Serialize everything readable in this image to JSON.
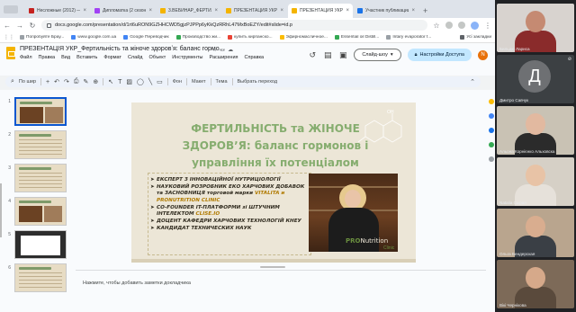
{
  "browser": {
    "tabs": [
      {
        "label": "Несложные (2012) — ...",
        "fav_color": "#c5221f",
        "active": false
      },
      {
        "label": "Дипломатка (2 сезон) ...",
        "fav_color": "#a142f4",
        "active": false
      },
      {
        "label": "3.ВЕБИНАР_ФЕРТИЛЬ...",
        "fav_color": "#f4b400",
        "active": false
      },
      {
        "label": "ПРЕЗЕНТАЦИЯ УКР_Фе...",
        "fav_color": "#f4b400",
        "active": false
      },
      {
        "label": "ПРЕЗЕНТАЦИЯ УКР_Фе...",
        "fav_color": "#f4b400",
        "active": true
      },
      {
        "label": "Участник публикации",
        "fav_color": "#1a73e8",
        "active": false
      }
    ],
    "new_tab": "+",
    "url": "docs.google.com/presentation/d/1rt6uRON9GZHHCWD5gjzPJPPp6yKkQzRRhL47MxBoEZY/edit#slide=id.p",
    "bookmarks": [
      {
        "label": "Попробуйте Брау...",
        "color": "#9aa0a6"
      },
      {
        "label": "www.google.com.ua",
        "color": "#4285f4"
      },
      {
        "label": "Google Переводчик",
        "color": "#4285f4"
      },
      {
        "label": "Производство жи...",
        "color": "#34a853"
      },
      {
        "label": "купить кирпанско...",
        "color": "#ea4335"
      },
      {
        "label": "Эфирномасличное...",
        "color": "#fbbc04"
      },
      {
        "label": "Essential oil Distill...",
        "color": "#34a853"
      },
      {
        "label": "Intary evaporator f...",
        "color": "#9aa0a6"
      }
    ],
    "all_bookmarks": "Усі закладки"
  },
  "docs": {
    "title": "ПРЕЗЕНТАЦІЯ УКР_Фертильність та жіноче здоровʼя: баланс гормо...",
    "menu": [
      "Файл",
      "Правка",
      "Вид",
      "Вставить",
      "Формат",
      "Слайд",
      "Объект",
      "Инструменты",
      "Расширения",
      "Справка"
    ],
    "slideshow_label": "Слайд-шоу",
    "access_label": "Настройки Доступа",
    "avatar_letter": "N",
    "toolbar": {
      "search_label": "По шир",
      "background_label": "Фон",
      "layout_label": "Макет",
      "theme_label": "Тема",
      "transition_label": "Выбрать переход"
    },
    "notes_placeholder": "Нажмите, чтобы добавить заметки докладчика"
  },
  "thumbnails": [
    {
      "num": "1",
      "style": "title",
      "selected": true
    },
    {
      "num": "2",
      "style": "lines",
      "selected": false
    },
    {
      "num": "3",
      "style": "lines",
      "selected": false
    },
    {
      "num": "4",
      "style": "title",
      "selected": false
    },
    {
      "num": "5",
      "style": "dark",
      "selected": false
    },
    {
      "num": "6",
      "style": "lines",
      "selected": false
    }
  ],
  "slide": {
    "title": "ФЕРТИЛЬНІСТЬ та ЖІНОЧЕ ЗДОРОВʼЯ: баланс гормонов і управління їх потенціалом",
    "items": [
      {
        "text": "ЕКСПЕРТ З ІННОВАЦІЙНОЇ НУТРИЦІОЛОГІЇ"
      },
      {
        "text": "НАУКОВИЙ РОЗРОБНИК ЕКО ХАРЧОВИХ ДОБАВОК та ЗАСНОВНИЦЯ торговой марки ",
        "hl": "VITALITA и PRONUTRITION CLINIC"
      },
      {
        "text": "CO-FOUNDER IT-ПЛАТФОРМИ зі ШТУЧНИМ ІНТЕЛЕКТОМ ",
        "hl": "CLISE.IO"
      },
      {
        "text": "ДОЦЕНТ КАФЕДРИ ХАРЧОВИХ ТЕХНОЛОГІЙ КНЕУ"
      },
      {
        "text": "КАНДИДАТ ТЕХНИЧЕСКИХ НАУК"
      }
    ],
    "brand_pro": "PRO",
    "brand_nu": "Nutrition",
    "brand_clinic": "Clinic",
    "molecule_label": "OH"
  },
  "participants": [
    {
      "name": "Бильдю Лариса",
      "type": "video",
      "bg": "#d8d3cf",
      "head": "#c58a72",
      "body": "#8a2b2b"
    },
    {
      "name": "Дмитро Савчук",
      "type": "avatar",
      "letter": "Д"
    },
    {
      "name": "Альона Корнієнко Альховска",
      "type": "video",
      "bg": "#c9c2b4",
      "head": "#e2b9a0",
      "body": "#2b2b2b"
    },
    {
      "name": "Natalia Сырая",
      "type": "video",
      "bg": "#d6d0c6",
      "head": "#e8c3a6",
      "body": "#e6e1da"
    },
    {
      "name": "Ольга Бендерская",
      "type": "video",
      "bg": "#b9a58e",
      "head": "#d9ad8f",
      "body": "#3a3f45"
    },
    {
      "name": "Вікі Чернікова",
      "type": "video",
      "bg": "#7d6a58",
      "head": "#d6a98a",
      "body": "#5a4a3c"
    }
  ]
}
